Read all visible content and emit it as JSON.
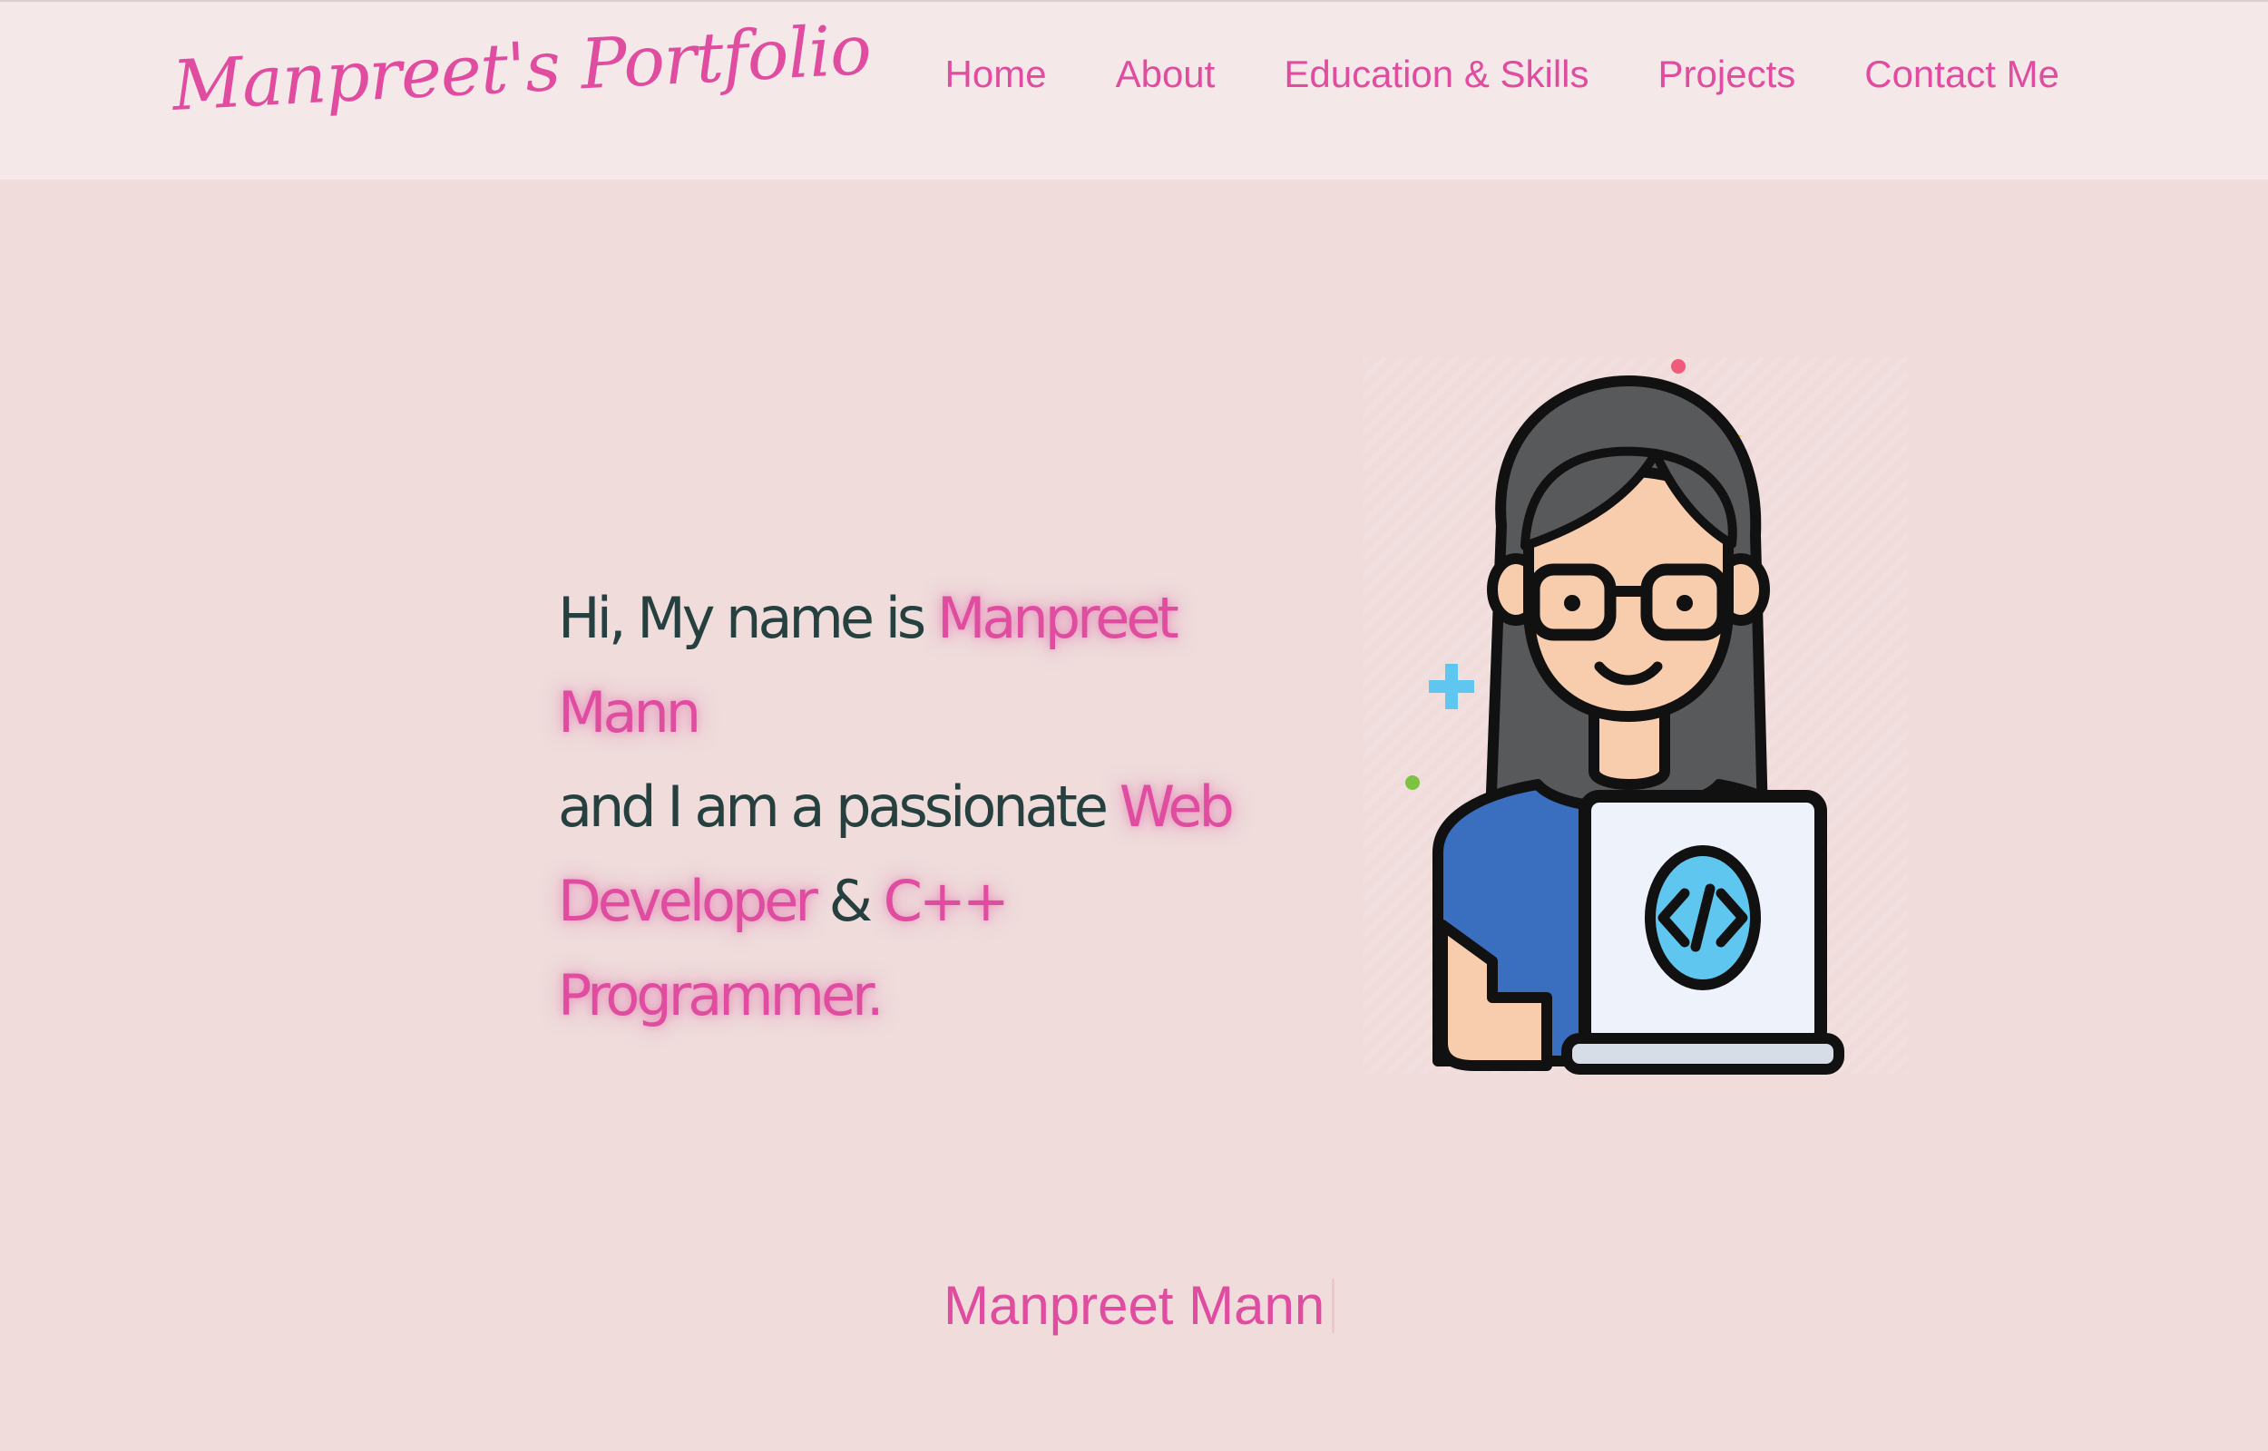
{
  "nav": {
    "logo": "Manpreet's Portfolio",
    "links": [
      "Home",
      "About",
      "Education & Skills",
      "Projects",
      "Contact Me"
    ]
  },
  "hero": {
    "line1_prefix": "Hi, My name is ",
    "name": "Manpreet Mann",
    "line2_prefix": "and I am a passionate ",
    "role1": "Web Developer",
    "connector": " & ",
    "role2": "C++ Programmer."
  },
  "typing": {
    "text": "Manpreet Mann"
  },
  "colors": {
    "accent": "#e04ca0",
    "text": "#25403f",
    "background": "#efdcdb",
    "navbar": "#f4e9e8"
  }
}
